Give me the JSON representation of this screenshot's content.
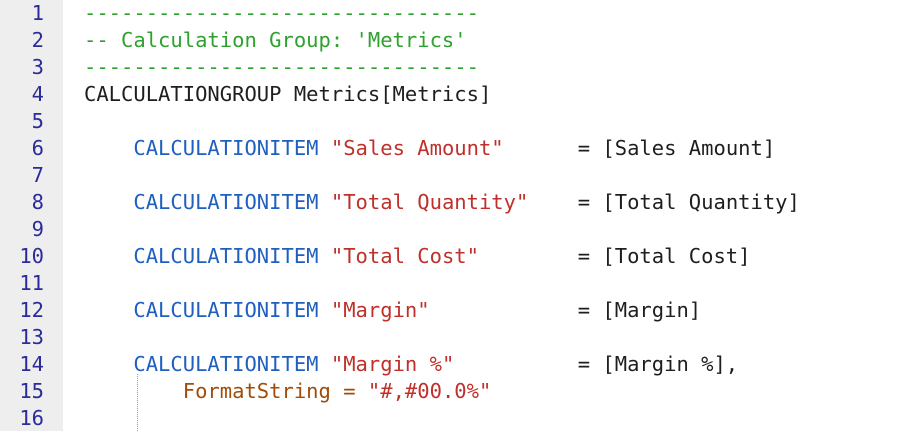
{
  "editor": {
    "line_numbers": [
      "1",
      "2",
      "3",
      "4",
      "5",
      "6",
      "7",
      "8",
      "9",
      "10",
      "11",
      "12",
      "13",
      "14",
      "15",
      "16"
    ],
    "lines": [
      [
        {
          "t": "comment",
          "v": "--------------------------------"
        }
      ],
      [
        {
          "t": "comment",
          "v": "-- Calculation Group: 'Metrics'"
        }
      ],
      [
        {
          "t": "comment",
          "v": "--------------------------------"
        }
      ],
      [
        {
          "t": "plain",
          "v": "CALCULATIONGROUP Metrics[Metrics]"
        }
      ],
      [],
      [
        {
          "t": "plain",
          "v": "    "
        },
        {
          "t": "keyword",
          "v": "CALCULATIONITEM"
        },
        {
          "t": "plain",
          "v": " "
        },
        {
          "t": "string",
          "v": "\"Sales Amount\""
        },
        {
          "t": "plain",
          "v": "      = [Sales Amount]"
        }
      ],
      [],
      [
        {
          "t": "plain",
          "v": "    "
        },
        {
          "t": "keyword",
          "v": "CALCULATIONITEM"
        },
        {
          "t": "plain",
          "v": " "
        },
        {
          "t": "string",
          "v": "\"Total Quantity\""
        },
        {
          "t": "plain",
          "v": "    = [Total Quantity]"
        }
      ],
      [],
      [
        {
          "t": "plain",
          "v": "    "
        },
        {
          "t": "keyword",
          "v": "CALCULATIONITEM"
        },
        {
          "t": "plain",
          "v": " "
        },
        {
          "t": "string",
          "v": "\"Total Cost\""
        },
        {
          "t": "plain",
          "v": "        = [Total Cost]"
        }
      ],
      [],
      [
        {
          "t": "plain",
          "v": "    "
        },
        {
          "t": "keyword",
          "v": "CALCULATIONITEM"
        },
        {
          "t": "plain",
          "v": " "
        },
        {
          "t": "string",
          "v": "\"Margin\""
        },
        {
          "t": "plain",
          "v": "            = [Margin]"
        }
      ],
      [],
      [
        {
          "t": "plain",
          "v": "    "
        },
        {
          "t": "keyword",
          "v": "CALCULATIONITEM"
        },
        {
          "t": "plain",
          "v": " "
        },
        {
          "t": "string",
          "v": "\"Margin %\""
        },
        {
          "t": "plain",
          "v": "          = [Margin %],"
        }
      ],
      [
        {
          "t": "plain",
          "v": "        "
        },
        {
          "t": "prop",
          "v": "FormatString"
        },
        {
          "t": "plain",
          "v": " "
        },
        {
          "t": "prop",
          "v": "="
        },
        {
          "t": "plain",
          "v": " "
        },
        {
          "t": "string",
          "v": "\"#,#00.0%\""
        }
      ],
      []
    ]
  },
  "colors": {
    "comment": "#2ea12e",
    "keyword": "#1f5fbf",
    "string": "#c0302b",
    "property": "#a14c0a",
    "plain": "#1e1e1e",
    "line_number": "#2b2b9a",
    "gutter_bg": "#eeeeee"
  }
}
